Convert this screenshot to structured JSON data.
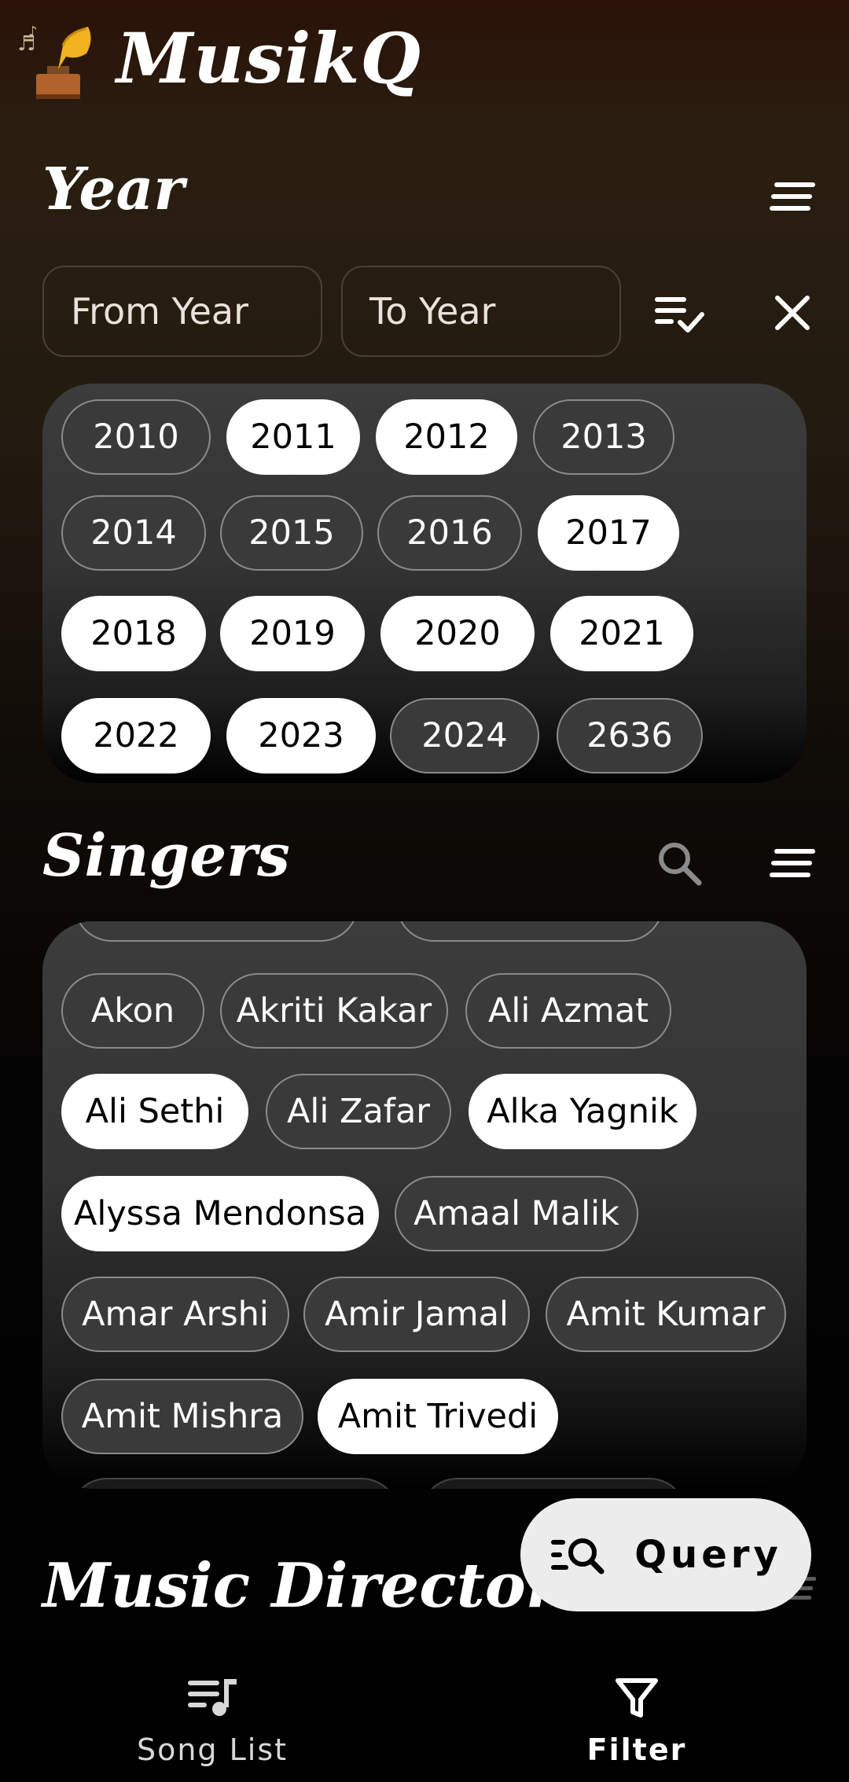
{
  "app": {
    "title": "MusikQ"
  },
  "year_section": {
    "title": "Year",
    "from_placeholder": "From Year",
    "to_placeholder": "To Year",
    "years": [
      {
        "label": "2010",
        "selected": false
      },
      {
        "label": "2011",
        "selected": true
      },
      {
        "label": "2012",
        "selected": true
      },
      {
        "label": "2013",
        "selected": false
      },
      {
        "label": "2014",
        "selected": false
      },
      {
        "label": "2015",
        "selected": false
      },
      {
        "label": "2016",
        "selected": false
      },
      {
        "label": "2017",
        "selected": true
      },
      {
        "label": "2018",
        "selected": true
      },
      {
        "label": "2019",
        "selected": true
      },
      {
        "label": "2020",
        "selected": true
      },
      {
        "label": "2021",
        "selected": true
      },
      {
        "label": "2022",
        "selected": true
      },
      {
        "label": "2023",
        "selected": true
      },
      {
        "label": "2024",
        "selected": false
      },
      {
        "label": "2636",
        "selected": false
      }
    ]
  },
  "singers_section": {
    "title": "Singers",
    "singers": [
      {
        "label": "Akon",
        "selected": false
      },
      {
        "label": "Akriti Kakar",
        "selected": false
      },
      {
        "label": "Ali Azmat",
        "selected": false
      },
      {
        "label": "Ali Sethi",
        "selected": true
      },
      {
        "label": "Ali Zafar",
        "selected": false
      },
      {
        "label": "Alka Yagnik",
        "selected": true
      },
      {
        "label": "Alyssa Mendonsa",
        "selected": true
      },
      {
        "label": "Amaal Malik",
        "selected": false
      },
      {
        "label": "Amar Arshi",
        "selected": false
      },
      {
        "label": "Amir Jamal",
        "selected": false
      },
      {
        "label": "Amit Kumar",
        "selected": false
      },
      {
        "label": "Amit Mishra",
        "selected": false
      },
      {
        "label": "Amit Trivedi",
        "selected": true
      }
    ]
  },
  "music_directors_section": {
    "title": "Music Directors"
  },
  "fab": {
    "label": "Query"
  },
  "bottom_nav": {
    "song_list_label": "Song List",
    "filter_label": "Filter",
    "active": "Filter"
  },
  "colors": {
    "chip_selected_bg": "#ffffff",
    "chip_unselected_bg": "#3a3a3a",
    "chip_border": "#8a8a8a",
    "fab_bg": "#ececec"
  }
}
